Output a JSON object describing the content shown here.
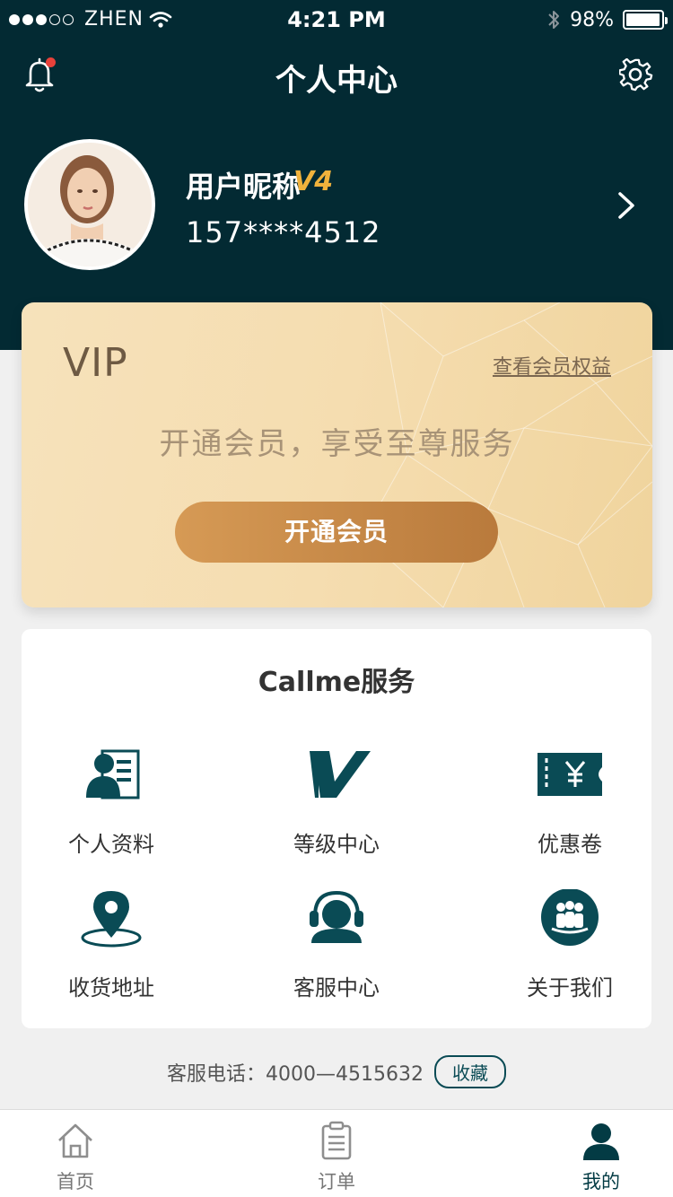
{
  "status_bar": {
    "carrier": "ZHEN",
    "time": "4:21 PM",
    "battery": "98%",
    "battery_level": 0.98
  },
  "nav": {
    "title": "个人中心",
    "left_icon": "bell-icon",
    "right_icon": "gear-icon"
  },
  "profile": {
    "name": "用户昵称",
    "level": "V4",
    "phone": "157****4512"
  },
  "vip": {
    "title": "VIP",
    "benefits_link": "查看会员权益",
    "tagline": "开通会员，享受至尊服务",
    "button_label": "开通会员"
  },
  "services": {
    "title": "Callme服务",
    "items": [
      {
        "label": "个人资料",
        "icon": "profile-card-icon"
      },
      {
        "label": "等级中心",
        "icon": "level-v-icon"
      },
      {
        "label": "优惠卷",
        "icon": "coupon-icon"
      },
      {
        "label": "收货地址",
        "icon": "location-pin-icon"
      },
      {
        "label": "客服中心",
        "icon": "headset-icon"
      },
      {
        "label": "关于我们",
        "icon": "group-icon"
      }
    ]
  },
  "hotline": {
    "label": "客服电话：",
    "number": "4000—4515632",
    "collect_button": "收藏"
  },
  "tabs": [
    {
      "label": "首页",
      "icon": "home-icon",
      "active": false
    },
    {
      "label": "订单",
      "icon": "order-clipboard-icon",
      "active": false
    },
    {
      "label": "我的",
      "icon": "user-icon",
      "active": true
    }
  ],
  "colors": {
    "header_bg": "#032a33",
    "accent": "#0a4b55",
    "gold": "#f0b23c",
    "badge": "#e8413a"
  }
}
